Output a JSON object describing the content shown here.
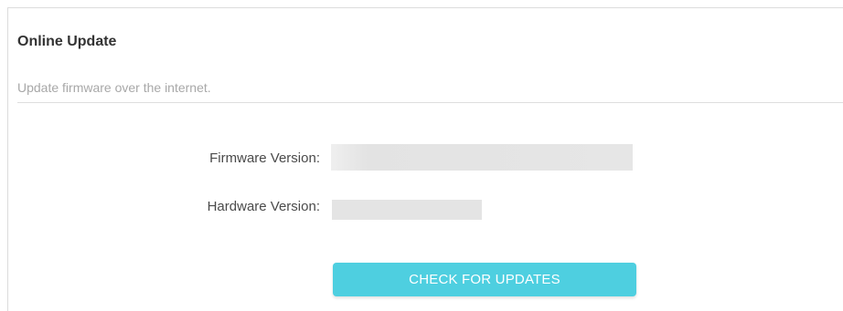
{
  "section": {
    "title": "Online Update",
    "subtitle": "Update firmware over the internet."
  },
  "fields": {
    "firmware_label": "Firmware Version:",
    "firmware_value": "",
    "hardware_label": "Hardware Version:",
    "hardware_value": ""
  },
  "actions": {
    "check_label": "CHECK FOR UPDATES"
  },
  "colors": {
    "accent": "#4ecfe0",
    "value_placeholder": "#e4e4e4",
    "title_text": "#333333",
    "subtitle_text": "#a8a8a8"
  }
}
